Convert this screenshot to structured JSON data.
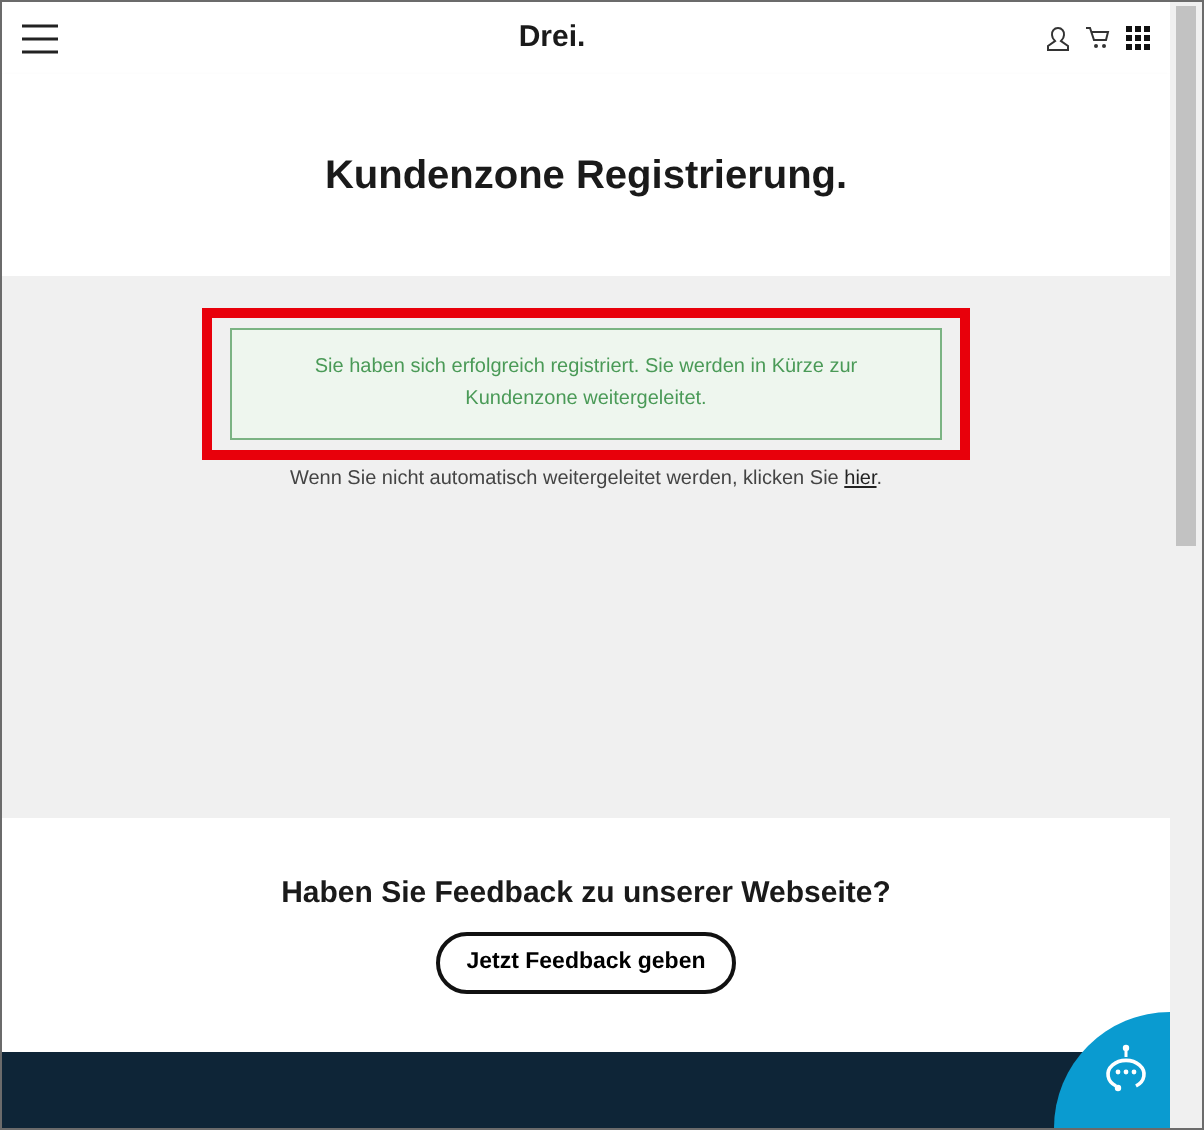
{
  "header": {
    "logo": "Drei."
  },
  "title": "Kundenzone Registrierung.",
  "success_message": "Sie haben sich erfolgreich registriert. Sie werden in Kürze zur Kundenzone weitergeleitet.",
  "redirect_note": {
    "text": "Wenn Sie nicht automatisch weitergeleitet werden, klicken Sie ",
    "link": "hier",
    "after": "."
  },
  "feedback": {
    "heading": "Haben Sie Feedback zu unserer Webseite?",
    "button": "Jetzt Feedback geben"
  }
}
